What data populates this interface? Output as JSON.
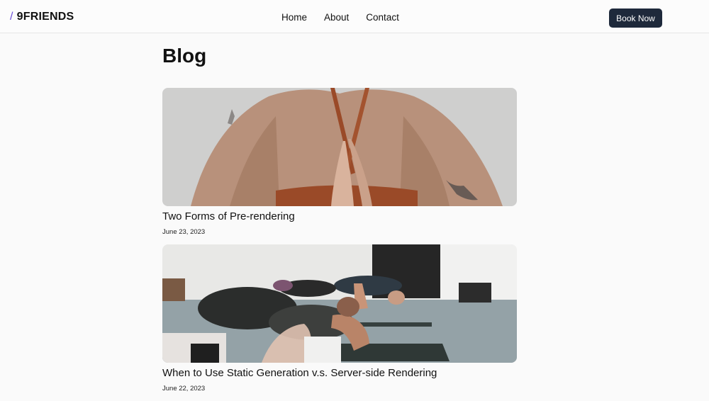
{
  "header": {
    "logo_slash": "/",
    "logo_text": "9FRIENDS",
    "nav": [
      {
        "label": "Home"
      },
      {
        "label": "About"
      },
      {
        "label": "Contact"
      }
    ],
    "cta_label": "Book Now"
  },
  "main": {
    "title": "Blog",
    "posts": [
      {
        "title": "Two Forms of Pre-rendering",
        "date": "June 23, 2023"
      },
      {
        "title": "When to Use Static Generation v.s. Server-side Rendering",
        "date": "June 22, 2023"
      }
    ]
  },
  "colors": {
    "accent": "#6b4fd8",
    "button_bg": "#1e293b",
    "page_bg": "#fafafa"
  }
}
